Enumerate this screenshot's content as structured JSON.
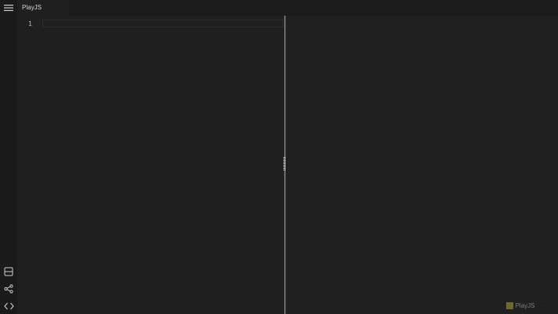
{
  "tabs": [
    {
      "label": "PlayJS"
    }
  ],
  "editor": {
    "line_numbers": [
      "1"
    ]
  },
  "activity_bar": {
    "top_icon": "menu-icon",
    "bottom_icons": [
      "layout-split-icon",
      "share-icon",
      "code-icon"
    ]
  },
  "preview": {
    "brand_label": "PlayJS",
    "brand_sub": "· · · ·",
    "brand_color": "#6f6a24"
  },
  "colors": {
    "background": "#1f1f1f",
    "activity_bar": "#1a1a1a",
    "splitter": "#6a6a6a"
  }
}
